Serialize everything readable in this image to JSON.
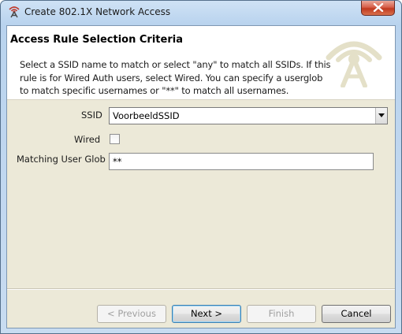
{
  "window": {
    "title": "Create 802.1X Network Access"
  },
  "header": {
    "title": "Access Rule Selection Criteria",
    "description": "Select a SSID name to match or select \"any\" to match all SSIDs. If this rule is for Wired Auth users, select Wired. You can specify a userglob to match specific usernames or \"**\" to match all usernames."
  },
  "form": {
    "ssid_label": "SSID",
    "ssid_value": "VoorbeeldSSID",
    "wired_label": "Wired",
    "wired_checked": false,
    "glob_label": "Matching User Glob",
    "glob_value": "**"
  },
  "buttons": {
    "previous": "< Previous",
    "next": "Next >",
    "finish": "Finish",
    "cancel": "Cancel"
  },
  "icons": {
    "app": "wifi-antenna-icon",
    "logo": "wireless-tower-icon",
    "close": "close-icon",
    "dropdown": "chevron-down-icon"
  },
  "colors": {
    "title_bar": "#b9d3ee",
    "client_bg": "#ece9d8",
    "close_button": "#c0391f",
    "logo": "#e4e0c8",
    "default_button_border": "#3c7fb1"
  }
}
